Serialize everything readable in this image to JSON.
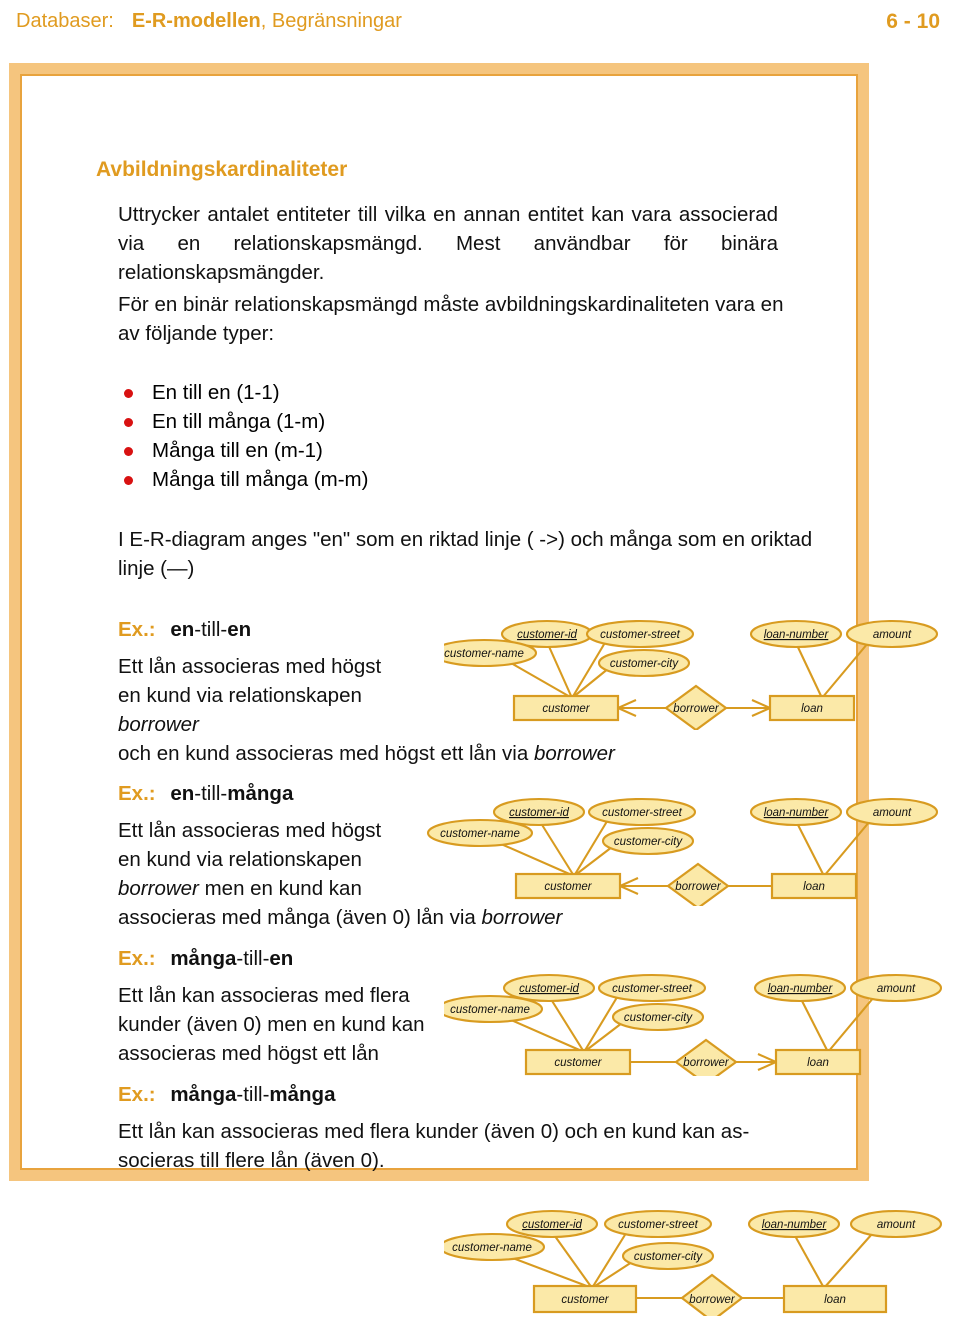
{
  "header": {
    "course_label": "Databaser:",
    "topic_bold": "E-R-modellen",
    "topic_rest": ", Begränsningar",
    "page_number": "6 - 10"
  },
  "slide": {
    "title": "Avbildningskardinaliteter",
    "para1": "Uttrycker antalet entiteter till vilka en annan entitet kan vara associerad via en relationskapsmängd. Mest användbar för binära relationskapsmängder.",
    "para2": "För en binär relationskapsmängd  måste avbildningskardinaliteten vara en av följande typer:",
    "bullets": [
      "En till en (1-1)",
      "En till många (1-m)",
      "Många till en (m-1)",
      "Många till många (m-m)"
    ],
    "para3": "I E-R-diagram anges \"en\" som en riktad linje ( ->) och många som en oriktad linje (—)"
  },
  "examples": [
    {
      "ex_label": "Ex.:",
      "kind_a": "en",
      "sep": "-till-",
      "kind_b": "en",
      "body_lines": [
        "Ett lån associeras med högst",
        "en kund via relationskapen",
        "borrower",
        "och en kund associeras med högst ett lån via borrower"
      ],
      "arrow_customer": true,
      "arrow_loan": true
    },
    {
      "ex_label": "Ex.:",
      "kind_a": "en",
      "sep": "-till-",
      "kind_b": "många",
      "body_lines": [
        "Ett lån associeras med högst",
        "en kund via relationskapen",
        "borrower men en kund kan",
        "associeras med många (även 0) lån via borrower"
      ],
      "arrow_customer": true,
      "arrow_loan": false
    },
    {
      "ex_label": "Ex.:",
      "kind_a": "många",
      "sep": "-till-",
      "kind_b": "en",
      "body_lines": [
        "Ett lån kan associeras med flera",
        "kunder (även 0) men en kund kan",
        "associeras med högst ett lån"
      ],
      "arrow_customer": false,
      "arrow_loan": true
    },
    {
      "ex_label": "Ex.:",
      "kind_a": "många",
      "sep": "-till-",
      "kind_b": "många",
      "body_lines": [
        "Ett lån kan associeras med flera kunder (även 0) och en kund kan as-",
        "socieras till flere lån (även 0)."
      ],
      "arrow_customer": false,
      "arrow_loan": false
    }
  ],
  "er_diagram": {
    "entities": [
      {
        "name": "customer"
      },
      {
        "name": "loan"
      }
    ],
    "relationship": {
      "name": "borrower"
    },
    "customer_attributes": [
      {
        "label": "customer-id",
        "key": true
      },
      {
        "label": "customer-name",
        "key": false
      },
      {
        "label": "customer-street",
        "key": false
      },
      {
        "label": "customer-city",
        "key": false
      }
    ],
    "loan_attributes": [
      {
        "label": "loan-number",
        "key": true
      },
      {
        "label": "amount",
        "key": false
      }
    ]
  },
  "colors": {
    "accent": "#E09B20",
    "frame_band": "#F5C57E",
    "frame_line": "#E8A33D",
    "entity_fill": "#FBE9A8",
    "entity_stroke": "#D89B20",
    "bullet_red": "#D81111",
    "text": "#111111"
  }
}
